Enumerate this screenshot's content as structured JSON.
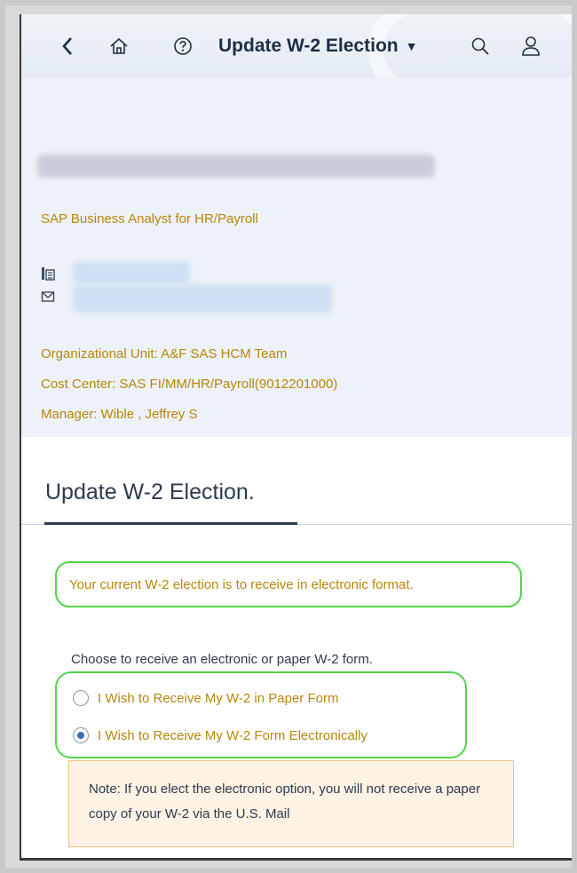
{
  "shell": {
    "title": "Update W-2 Election",
    "caret": "▼",
    "icons": {
      "back": "chevron-left-icon",
      "home": "home-icon",
      "help": "help-icon",
      "search": "search-icon",
      "user": "user-icon"
    }
  },
  "profile": {
    "job_title": "SAP Business Analyst for HR/Payroll",
    "org_unit": "Organizational Unit: A&F SAS HCM Team",
    "cost_center": "Cost Center: SAS FI/MM/HR/Payroll(9012201000)",
    "manager": "Manager: Wible , Jeffrey S"
  },
  "section": {
    "title": "Update W-2 Election."
  },
  "election": {
    "current_text": "Your current W-2 election is to receive in electronic format.",
    "choose_text": "Choose to receive an electronic or paper W-2 form.",
    "options": [
      {
        "label": "I Wish to Receive My W-2 in Paper Form",
        "selected": false
      },
      {
        "label": "I Wish to Receive My W-2 Form Electronically",
        "selected": true
      }
    ],
    "note": "Note: If you elect the electronic option, you will not receive a paper copy of your W-2 via the U.S. Mail"
  },
  "colors": {
    "accent_gold": "#b7860b",
    "highlight_green": "#52d44a",
    "note_bg": "#fdf2e3"
  }
}
